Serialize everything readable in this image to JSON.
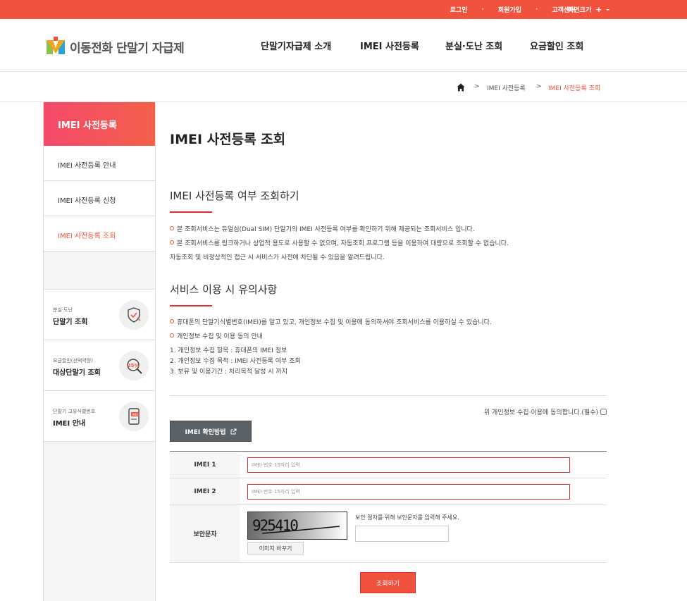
{
  "topbar": {
    "links": [
      "로그인",
      "회원가입",
      "고객센터"
    ],
    "zoom_label": "화면크기",
    "zoom_in": "+",
    "zoom_out": "-"
  },
  "header": {
    "logo_text": "이동전화 단말기 자급제",
    "nav": [
      "단말기자급제 소개",
      "IMEI 사전등록",
      "분실·도난 조회",
      "요금할인 조회"
    ]
  },
  "breadcrumb": {
    "separator": ">",
    "items": [
      "IMEI 사전등록",
      "IMEI 사전등록 조회"
    ]
  },
  "sidebar": {
    "title": "IMEI 사전등록",
    "items": [
      {
        "label": "IMEI 사전등록 안내"
      },
      {
        "label": "IMEI 사전등록 신청"
      },
      {
        "label": "IMEI 사전등록 조회"
      }
    ],
    "quick": [
      {
        "sub": "분실·도난",
        "title": "단말기 조회"
      },
      {
        "sub": "요금할인(선택약정)",
        "title": "대상단말기 조회",
        "badge": "25%"
      },
      {
        "sub": "단말기 고유식별번호",
        "title": "IMEI 안내",
        "badge": "IMEI"
      }
    ]
  },
  "main": {
    "page_title": "IMEI 사전등록 조회",
    "section1": {
      "title": "IMEI 사전등록 여부 조회하기",
      "bullets": [
        "본 조회서비스는 듀얼심(Dual SIM) 단말기의 IMEI 사전등록 여부를 확인하기 위해 제공되는 조회서비스 입니다.",
        "본 조회서비스를 링크하거나 상업적 용도로 사용할 수 없으며, 자동조회 프로그램 등을 이용하여 대량으로 조회할 수 없습니다."
      ],
      "note": "자동조회 및 비정상적인 접근 시 서비스가 사전에 차단될 수 있음을 알려드립니다."
    },
    "section2": {
      "title": "서비스 이용 시 유의사항",
      "bullets": [
        "휴대폰의 단말기식별번호(IMEI)를 알고 있고, 개인정보 수집 및 이용에 동의하셔야 조회서비스를 이용하실 수 있습니다.",
        "개인정보 수집 및 이용 동의 안내"
      ],
      "items": [
        "1. 개인정보 수집 항목 : 휴대폰의 IMEI 정보",
        "2. 개인정보 수집 목적 : IMEI 사전등록 여부 조회",
        "3. 보유 및 이용기간 : 처리목적 달성 시 까지"
      ]
    },
    "agree_label": "위 개인정보 수집·이용에 동의합니다.(필수)",
    "imei_button": "IMEI 확인방법",
    "form": {
      "imei1_label": "IMEI 1",
      "imei1_placeholder": "IMEI 번호 15자리 입력",
      "imei2_label": "IMEI 2",
      "imei2_placeholder": "IMEI 번호 15자리 입력",
      "captcha_label": "보안문자",
      "captcha_text": "925410",
      "captcha_note": "보안 절차를 위해 보안문자를 입력해 주세요.",
      "captcha_refresh": "이미지 바꾸기"
    },
    "submit_label": "조회하기"
  },
  "colors": {
    "accent": "#f0523e",
    "dark_button": "#5a6268"
  }
}
